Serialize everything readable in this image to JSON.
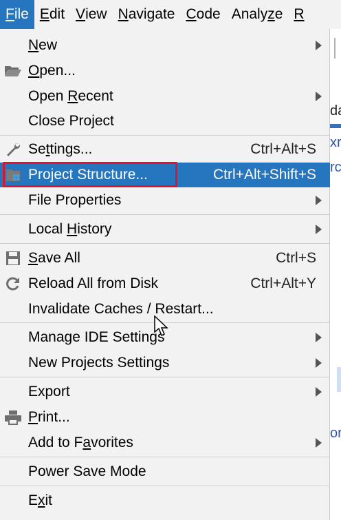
{
  "menubar": {
    "items": [
      {
        "pre": "",
        "mn": "F",
        "post": "ile"
      },
      {
        "pre": "",
        "mn": "E",
        "post": "dit"
      },
      {
        "pre": "",
        "mn": "V",
        "post": "iew"
      },
      {
        "pre": "",
        "mn": "N",
        "post": "avigate"
      },
      {
        "pre": "",
        "mn": "C",
        "post": "ode"
      },
      {
        "pre": "Analy",
        "mn": "z",
        "post": "e"
      },
      {
        "pre": "",
        "mn": "R",
        "post": ""
      }
    ]
  },
  "background": {
    "fragments": [
      "da",
      "xr",
      "rc",
      "or"
    ]
  },
  "menu": {
    "new": {
      "pre": "",
      "mn": "N",
      "post": "ew"
    },
    "open": {
      "pre": "",
      "mn": "O",
      "post": "pen..."
    },
    "open_recent": {
      "pre": "Open ",
      "mn": "R",
      "post": "ecent"
    },
    "close_project": {
      "label": "Close Project"
    },
    "settings": {
      "pre": "Se",
      "mn": "t",
      "post": "tings...",
      "shortcut": "Ctrl+Alt+S"
    },
    "project_structure": {
      "label": "Project Structure...",
      "shortcut": "Ctrl+Alt+Shift+S"
    },
    "file_properties": {
      "label": "File Properties"
    },
    "local_history": {
      "pre": "Local ",
      "mn": "H",
      "post": "istory"
    },
    "save_all": {
      "pre": "",
      "mn": "S",
      "post": "ave All",
      "shortcut": "Ctrl+S"
    },
    "reload": {
      "label": "Reload All from Disk",
      "shortcut": "Ctrl+Alt+Y"
    },
    "invalidate": {
      "label": "Invalidate Caches / Restart..."
    },
    "manage_ide": {
      "label": "Manage IDE Settings"
    },
    "new_projects": {
      "label": "New Projects Settings"
    },
    "export": {
      "label": "Export"
    },
    "print": {
      "pre": "",
      "mn": "P",
      "post": "rint..."
    },
    "favorites": {
      "pre": "Add to F",
      "mn": "a",
      "post": "vorites"
    },
    "power_save": {
      "label": "Power Save Mode"
    },
    "exit": {
      "pre": "E",
      "mn": "x",
      "post": "it"
    }
  },
  "colors": {
    "selection": "#2675bf",
    "highlight_box": "#e0142b",
    "link_text": "#2f55a6"
  }
}
